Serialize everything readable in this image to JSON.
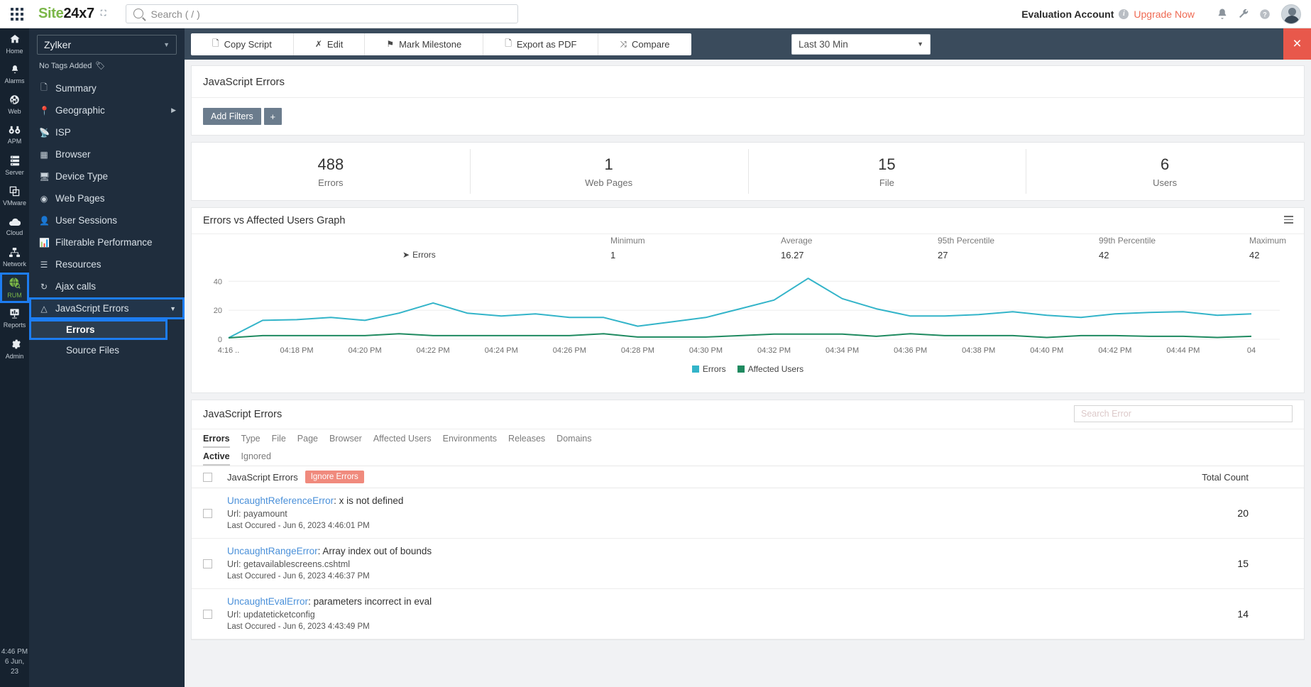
{
  "topbar": {
    "brand_left": "Site",
    "brand_right": "24x7",
    "search_placeholder": "Search ( / )",
    "account_label": "Evaluation Account",
    "upgrade_label": "Upgrade Now"
  },
  "rail": {
    "items": [
      {
        "label": "Home",
        "icon": "home-icon",
        "glyph": "⌂"
      },
      {
        "label": "Alarms",
        "icon": "bell-icon",
        "glyph": "🔔"
      },
      {
        "label": "Web",
        "icon": "globe-icon",
        "glyph": "🌐"
      },
      {
        "label": "APM",
        "icon": "binoculars-icon",
        "glyph": "∞"
      },
      {
        "label": "Server",
        "icon": "server-icon",
        "glyph": "≡"
      },
      {
        "label": "VMware",
        "icon": "layers-icon",
        "glyph": "⧉"
      },
      {
        "label": "Cloud",
        "icon": "cloud-icon",
        "glyph": "☁"
      },
      {
        "label": "Network",
        "icon": "network-icon",
        "glyph": "⛓"
      },
      {
        "label": "RUM",
        "icon": "rum-globe-icon",
        "glyph": "🌍",
        "active": true
      },
      {
        "label": "Reports",
        "icon": "reports-icon",
        "glyph": "📊"
      },
      {
        "label": "Admin",
        "icon": "gear-icon",
        "glyph": "⚙"
      }
    ],
    "clock_time": "4:46 PM",
    "clock_date": "6 Jun, 23"
  },
  "sidebar": {
    "monitor_name": "Zylker",
    "tags_label": "No Tags Added",
    "items": [
      {
        "label": "Summary",
        "icon": "document-icon",
        "glyph": "὜E"
      },
      {
        "label": "Geographic",
        "icon": "map-pin-icon",
        "glyph": "⌖",
        "has_submenu_arrow": true
      },
      {
        "label": "ISP",
        "icon": "isp-icon",
        "glyph": "⚒"
      },
      {
        "label": "Browser",
        "icon": "browser-window-icon",
        "glyph": "▤"
      },
      {
        "label": "Device Type",
        "icon": "monitor-icon",
        "glyph": "▭"
      },
      {
        "label": "Web Pages",
        "icon": "web-pages-icon",
        "glyph": "◕"
      },
      {
        "label": "User Sessions",
        "icon": "user-icon",
        "glyph": "▲"
      },
      {
        "label": "Filterable Performance",
        "icon": "chart-icon",
        "glyph": "↗"
      },
      {
        "label": "Resources",
        "icon": "database-icon",
        "glyph": "≣"
      },
      {
        "label": "Ajax calls",
        "icon": "refresh-icon",
        "glyph": "↻"
      },
      {
        "label": "JavaScript Errors",
        "icon": "warning-triangle-icon",
        "glyph": "⚠",
        "expanded": true,
        "highlighted": true
      }
    ],
    "submenu": [
      {
        "label": "Errors",
        "active": true,
        "highlighted": true
      },
      {
        "label": "Source Files",
        "active": false,
        "highlighted": false
      }
    ]
  },
  "actionbar": {
    "actions": [
      {
        "label": "Copy Script",
        "icon": "copy-icon",
        "glyph": "⧉"
      },
      {
        "label": "Edit",
        "icon": "edit-icon",
        "glyph": "✂"
      },
      {
        "label": "Mark Milestone",
        "icon": "flag-icon",
        "glyph": "⚑"
      },
      {
        "label": "Export as PDF",
        "icon": "pdf-icon",
        "glyph": "὜B"
      },
      {
        "label": "Compare",
        "icon": "compare-icon",
        "glyph": "⤨"
      }
    ],
    "period": "Last 30 Min",
    "close_label": "×"
  },
  "page": {
    "title": "JavaScript Errors",
    "add_filters_label": "Add Filters",
    "plus_label": "+"
  },
  "stats": [
    {
      "value": "488",
      "label": "Errors"
    },
    {
      "value": "1",
      "label": "Web Pages"
    },
    {
      "value": "15",
      "label": "File"
    },
    {
      "value": "6",
      "label": "Users"
    }
  ],
  "chart_panel": {
    "title": "Errors vs Affected Users Graph",
    "series_label": "Errors",
    "summary_headers": [
      "Minimum",
      "Average",
      "95th Percentile",
      "99th Percentile",
      "Maximum"
    ],
    "summary_values": [
      "1",
      "16.27",
      "27",
      "42",
      "42"
    ]
  },
  "chart_data": {
    "type": "line",
    "title": "Errors vs Affected Users Graph",
    "xlabel": "",
    "ylabel": "",
    "ylim": [
      0,
      46
    ],
    "yticks": [
      0,
      20,
      40
    ],
    "grid": true,
    "legend_position": "bottom",
    "colors": {
      "Errors": "#33b4c9",
      "Affected Users": "#1f8a60"
    },
    "x_tick_labels": [
      "4:16 ..",
      "04:18 PM",
      "04:20 PM",
      "04:22 PM",
      "04:24 PM",
      "04:26 PM",
      "04:28 PM",
      "04:30 PM",
      "04:32 PM",
      "04:34 PM",
      "04:36 PM",
      "04:38 PM",
      "04:40 PM",
      "04:42 PM",
      "04:44 PM",
      "04"
    ],
    "x": [
      "04:16",
      "04:17",
      "04:18",
      "04:19",
      "04:20",
      "04:21",
      "04:22",
      "04:23",
      "04:24",
      "04:25",
      "04:26",
      "04:27",
      "04:28",
      "04:29",
      "04:30",
      "04:31",
      "04:32",
      "04:33",
      "04:34",
      "04:35",
      "04:36",
      "04:37",
      "04:38",
      "04:39",
      "04:40",
      "04:41",
      "04:42",
      "04:43",
      "04:44",
      "04:45",
      "04:46"
    ],
    "series": [
      {
        "name": "Errors",
        "color": "#33b4c9",
        "values": [
          1,
          13,
          13.5,
          15,
          13,
          18,
          25,
          18,
          16,
          17.5,
          15,
          15,
          9,
          12,
          15,
          21,
          27,
          42,
          28,
          21,
          16,
          16,
          17,
          19,
          16.5,
          15,
          17.5,
          18.5,
          19,
          16.5,
          17.5
        ]
      },
      {
        "name": "Affected Users",
        "color": "#1f8a60",
        "values": [
          1,
          2.5,
          2.5,
          2.5,
          2.5,
          3.8,
          2.5,
          2.5,
          2.5,
          2.5,
          2.5,
          3.8,
          1.5,
          1.5,
          1.5,
          2.5,
          3.5,
          3.5,
          3.5,
          2,
          3.8,
          2.5,
          2.5,
          2.5,
          1.2,
          2.5,
          2.5,
          2,
          2,
          1.2,
          2
        ]
      }
    ],
    "legend": [
      "Errors",
      "Affected Users"
    ]
  },
  "table": {
    "title": "JavaScript Errors",
    "search_placeholder": "Search Error",
    "tabs": [
      "Errors",
      "Type",
      "File",
      "Page",
      "Browser",
      "Affected Users",
      "Environments",
      "Releases",
      "Domains"
    ],
    "active_tab": "Errors",
    "subtabs": [
      "Active",
      "Ignored"
    ],
    "active_subtab": "Active",
    "header_label": "JavaScript Errors",
    "ignore_button": "Ignore Errors",
    "count_header": "Total Count",
    "rows": [
      {
        "error_type": "UncaughtReferenceError",
        "error_message": ": x is not defined",
        "url_label": "Url:",
        "url_value": "payamount",
        "last_occured": "Last Occured - Jun 6, 2023 4:46:01 PM",
        "count": "20"
      },
      {
        "error_type": "UncaughtRangeError",
        "error_message": ": Array index out of bounds",
        "url_label": "Url:",
        "url_value": "getavailablescreens.cshtml",
        "last_occured": "Last Occured - Jun 6, 2023 4:46:37 PM",
        "count": "15"
      },
      {
        "error_type": "UncaughtEvalError",
        "error_message": ": parameters incorrect in eval",
        "url_label": "Url:",
        "url_value": "updateticketconfig",
        "last_occured": "Last Occured - Jun 6, 2023 4:43:49 PM",
        "count": "14"
      }
    ]
  }
}
